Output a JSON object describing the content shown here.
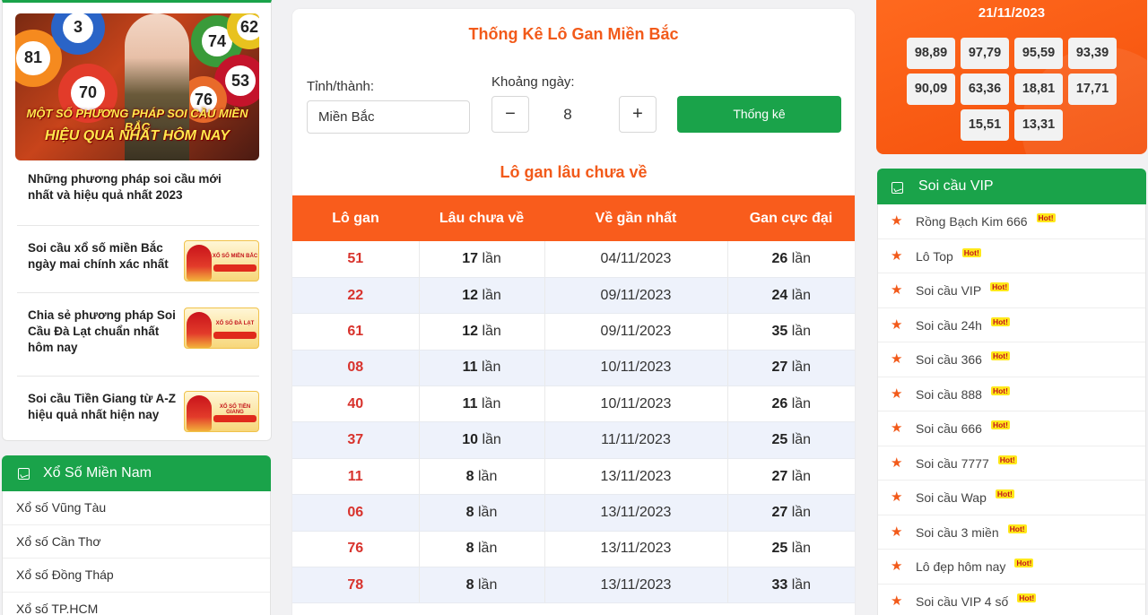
{
  "left": {
    "hero": {
      "image_text_line1": "MỘT SỐ PHƯƠNG PHÁP SOI CẦU MIỀN BẮC",
      "image_text_line2": "HIỆU QUẢ NHẤT HÔM NAY",
      "balls": [
        "81",
        "74",
        "62",
        "53",
        "70",
        "3",
        "76"
      ],
      "caption": "Những phương pháp soi cầu mới nhất và hiệu quả nhất 2023"
    },
    "articles": [
      {
        "title": "Soi cầu xổ số miền Bắc ngày mai chính xác nhất",
        "thumb_title": "XỔ SỐ MIỀN BẮC"
      },
      {
        "title": "Chia sẻ phương pháp Soi Cầu Đà Lạt chuẩn nhất hôm nay",
        "thumb_title": "XỔ SỐ ĐÀ LẠT"
      },
      {
        "title": "Soi cầu Tiền Giang từ A-Z hiệu quả nhất hiện nay",
        "thumb_title": "XỔ SỐ TIỀN GIANG"
      }
    ],
    "mien_nam": {
      "title": "Xổ Số Miền Nam",
      "items": [
        "Xổ số Vũng Tàu",
        "Xổ số Cần Thơ",
        "Xổ số Đồng Tháp",
        "Xổ số TP.HCM"
      ]
    }
  },
  "center": {
    "title": "Thống Kê Lô Gan Miền Bắc",
    "province_label": "Tỉnh/thành:",
    "province_value": "Miền Bắc",
    "range_label": "Khoảng ngày:",
    "minus": "−",
    "plus": "+",
    "range_value": "8",
    "submit": "Thống kê",
    "subtitle": "Lô gan lâu chưa về",
    "columns": [
      "Lô gan",
      "Lâu chưa về",
      "Về gần nhất",
      "Gan cực đại"
    ],
    "unit": "lần",
    "rows": [
      {
        "lo": "51",
        "lau": "17",
        "ve": "04/11/2023",
        "max": "26"
      },
      {
        "lo": "22",
        "lau": "12",
        "ve": "09/11/2023",
        "max": "24"
      },
      {
        "lo": "61",
        "lau": "12",
        "ve": "09/11/2023",
        "max": "35"
      },
      {
        "lo": "08",
        "lau": "11",
        "ve": "10/11/2023",
        "max": "27"
      },
      {
        "lo": "40",
        "lau": "11",
        "ve": "10/11/2023",
        "max": "26"
      },
      {
        "lo": "37",
        "lau": "10",
        "ve": "11/11/2023",
        "max": "25"
      },
      {
        "lo": "11",
        "lau": "8",
        "ve": "13/11/2023",
        "max": "27"
      },
      {
        "lo": "06",
        "lau": "8",
        "ve": "13/11/2023",
        "max": "27"
      },
      {
        "lo": "76",
        "lau": "8",
        "ve": "13/11/2023",
        "max": "25"
      },
      {
        "lo": "78",
        "lau": "8",
        "ve": "13/11/2023",
        "max": "33"
      }
    ]
  },
  "right": {
    "date": "21/11/2023",
    "numbers": [
      "98,89",
      "97,79",
      "95,59",
      "93,39",
      "90,09",
      "63,36",
      "18,81",
      "17,71",
      "15,51",
      "13,31"
    ],
    "vip": {
      "title": "Soi cầu VIP",
      "hot_label": "Hot!",
      "items": [
        "Rồng Bạch Kim 666",
        "Lô Top",
        "Soi cầu VIP",
        "Soi cầu 24h",
        "Soi cầu 366",
        "Soi cầu 888",
        "Soi cầu 666",
        "Soi cầu 7777",
        "Soi cầu Wap",
        "Soi cầu 3 miền",
        "Lô đẹp hôm nay",
        "Soi cầu VIP 4 số"
      ]
    }
  },
  "colors": {
    "green": "#1aa34a",
    "orange": "#f95c1c",
    "red_number": "#d8332d"
  }
}
